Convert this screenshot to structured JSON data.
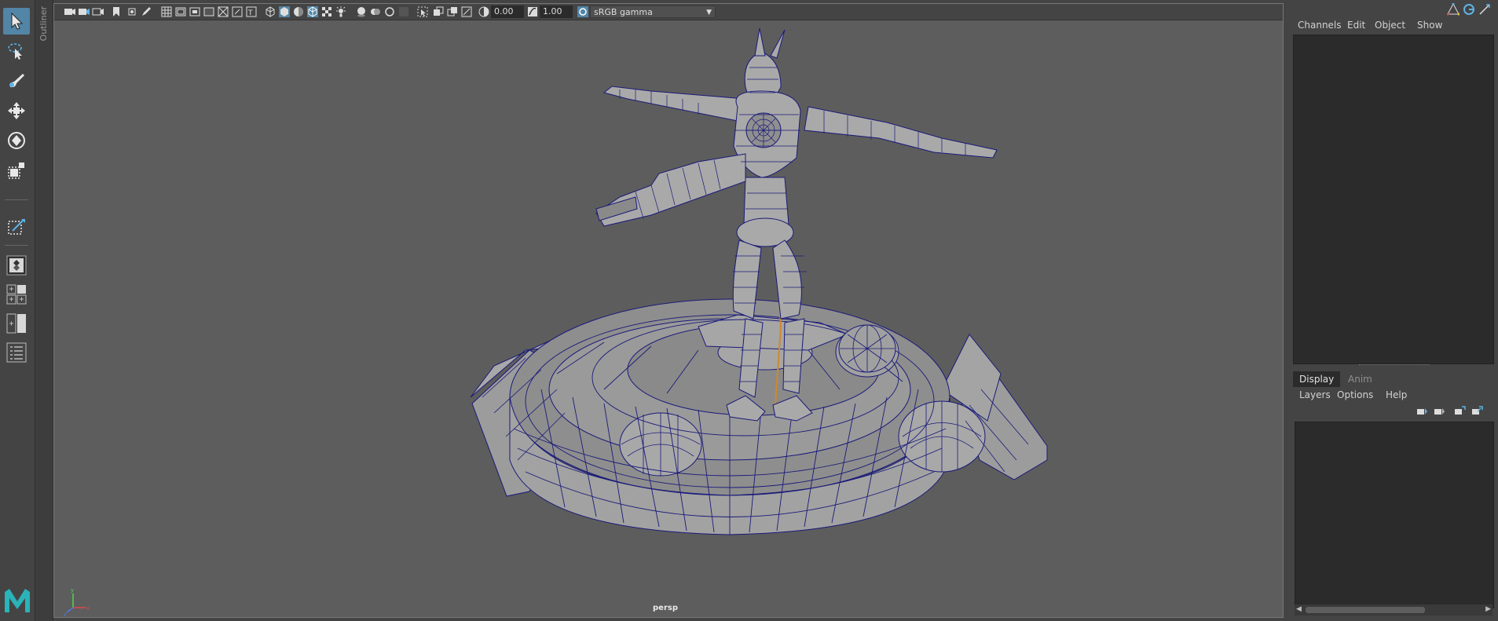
{
  "app": {
    "name": "Maya",
    "accent": "#5285a6",
    "logo_color": "#2ab3b8"
  },
  "outliner": {
    "label": "Outliner"
  },
  "viewport": {
    "camera_label": "persp",
    "exposure": "0.00",
    "gamma": "1.00",
    "color_space": "sRGB gamma",
    "wire_color": "#1a1a7a",
    "bg_color": "#5d5d5d"
  },
  "channel_box": {
    "menu": [
      "Channels",
      "Edit",
      "Object",
      "Show"
    ]
  },
  "layer_editor": {
    "tabs": [
      {
        "label": "Display",
        "active": true
      },
      {
        "label": "Anim",
        "active": false
      }
    ],
    "menu": [
      "Layers",
      "Options",
      "Help"
    ]
  }
}
